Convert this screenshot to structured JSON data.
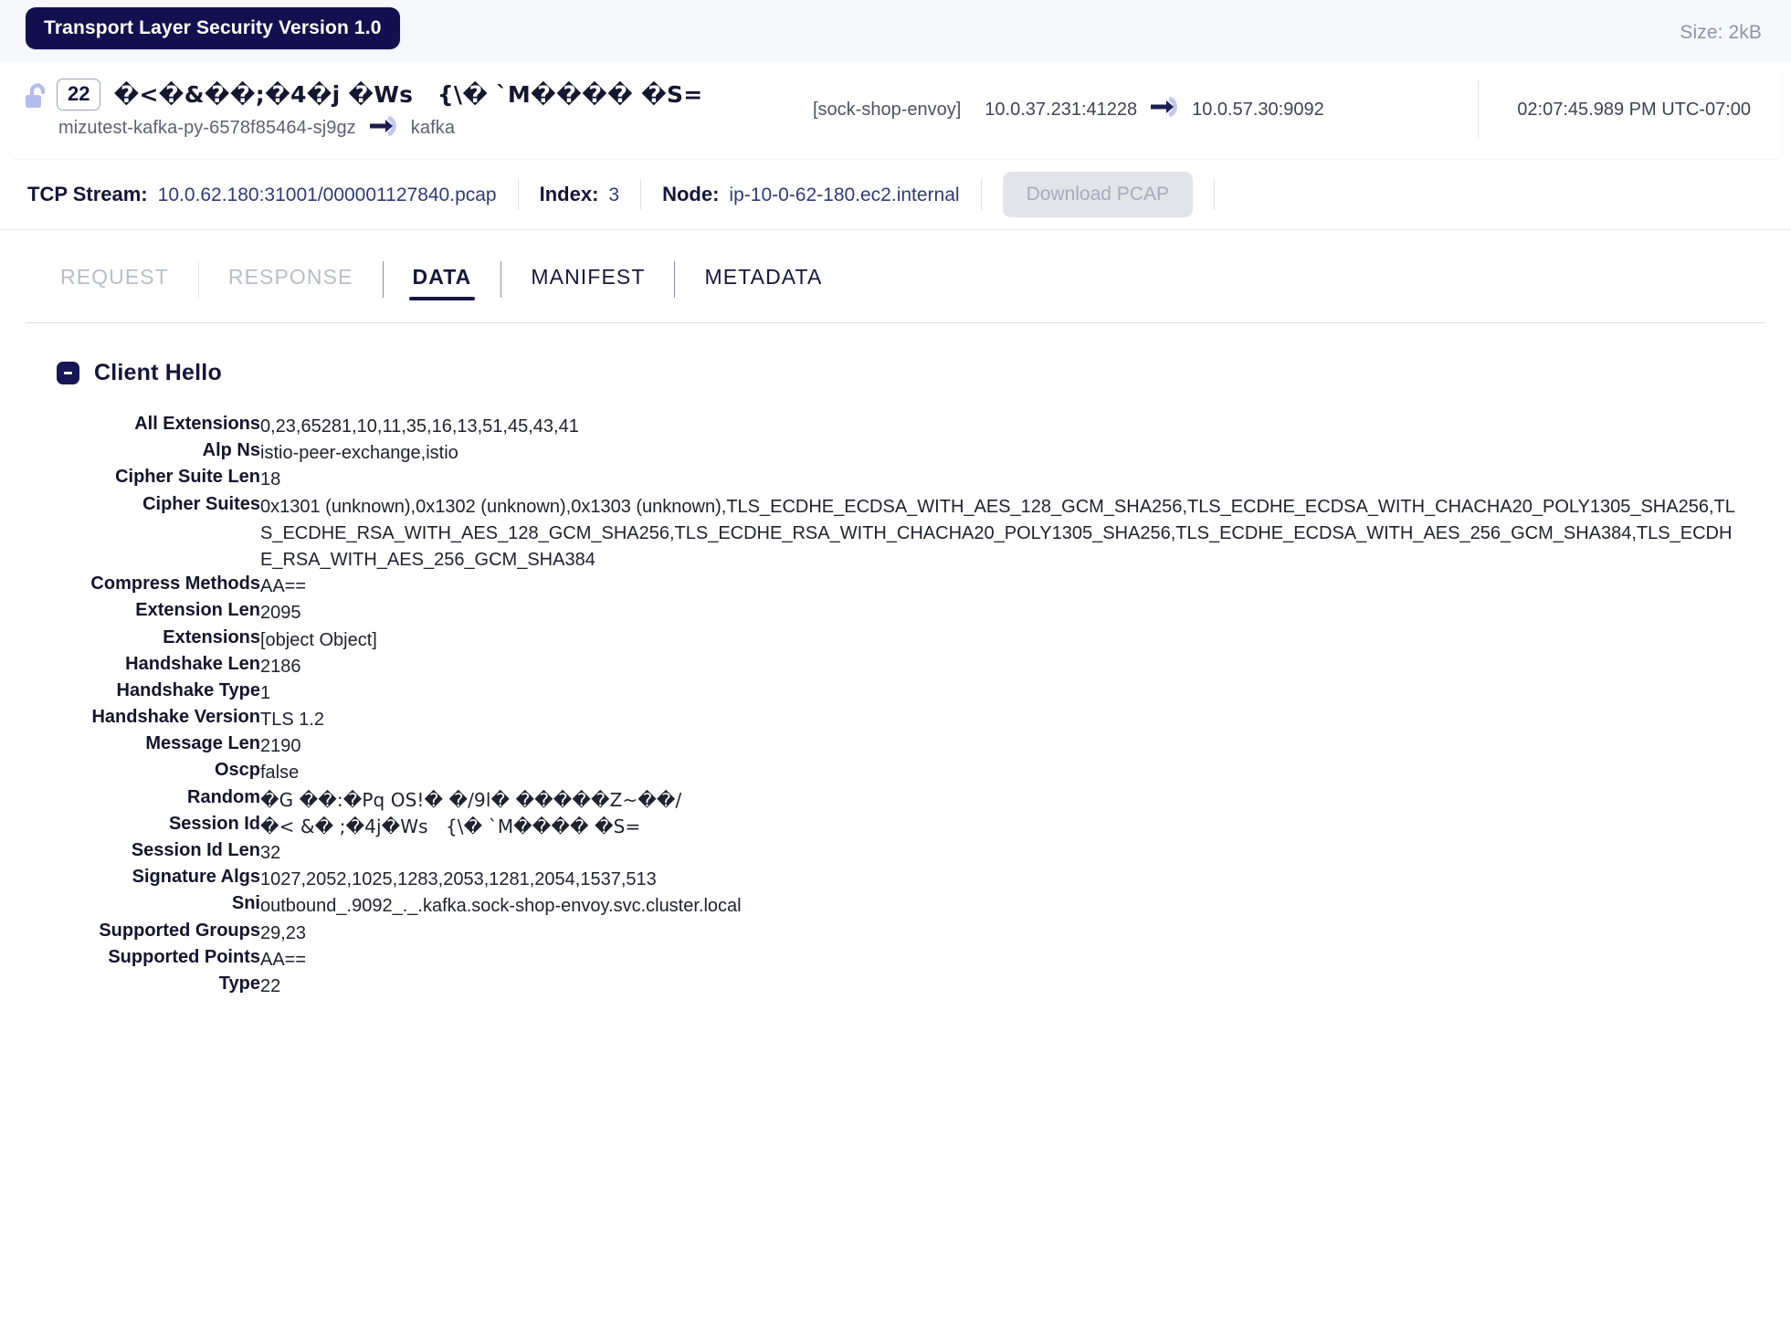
{
  "header": {
    "protocol_pill": "Transport Layer Security Version 1.0",
    "size_label": "Size: 2kB",
    "unlock_icon": "unlock-icon",
    "port_badge": "22",
    "payload_preview": "�<�&��;�4�j �Ws   {\\� `M���� �S=",
    "pod_name": "mizutest-kafka-py-6578f85464-sj9gz",
    "flow_arrow_icon": "arrow-right-icon",
    "service_name": "kafka",
    "envoy_tag": "[sock-shop-envoy]",
    "src_addr": "10.0.37.231:41228",
    "addr_arrow_icon": "arrow-right-icon",
    "dst_addr": "10.0.57.30:9092",
    "timestamp": "02:07:45.989 PM UTC-07:00"
  },
  "stream_bar": {
    "tcp_stream_key": "TCP Stream:",
    "tcp_stream_value": "10.0.62.180:31001/000001127840.pcap",
    "index_key": "Index:",
    "index_value": "3",
    "node_key": "Node:",
    "node_value": "ip-10-0-62-180.ec2.internal",
    "download_button": "Download PCAP"
  },
  "tabs": [
    {
      "label": "REQUEST",
      "state": "disabled"
    },
    {
      "label": "RESPONSE",
      "state": "disabled"
    },
    {
      "label": "DATA",
      "state": "active"
    },
    {
      "label": "MANIFEST",
      "state": "normal"
    },
    {
      "label": "METADATA",
      "state": "normal"
    }
  ],
  "section": {
    "title": "Client Hello",
    "collapse_icon": "minus-icon",
    "expanded": true,
    "fields": [
      {
        "key": "All Extensions",
        "value": "0,23,65281,10,11,35,16,13,51,45,43,41"
      },
      {
        "key": "Alp Ns",
        "value": "istio-peer-exchange,istio"
      },
      {
        "key": "Cipher Suite Len",
        "value": "18"
      },
      {
        "key": "Cipher Suites",
        "value": "0x1301 (unknown),0x1302 (unknown),0x1303 (unknown),TLS_ECDHE_ECDSA_WITH_AES_128_GCM_SHA256,TLS_ECDHE_ECDSA_WITH_CHACHA20_POLY1305_SHA256,TLS_ECDHE_RSA_WITH_AES_128_GCM_SHA256,TLS_ECDHE_RSA_WITH_CHACHA20_POLY1305_SHA256,TLS_ECDHE_ECDSA_WITH_AES_256_GCM_SHA384,TLS_ECDHE_RSA_WITH_AES_256_GCM_SHA384"
      },
      {
        "key": "Compress Methods",
        "value": "AA=="
      },
      {
        "key": "Extension Len",
        "value": "2095"
      },
      {
        "key": "Extensions",
        "value": "[object Object]"
      },
      {
        "key": "Handshake Len",
        "value": "2186"
      },
      {
        "key": "Handshake Type",
        "value": "1"
      },
      {
        "key": "Handshake Version",
        "value": "TLS 1.2"
      },
      {
        "key": "Message Len",
        "value": "2190"
      },
      {
        "key": "Oscp",
        "value": "false"
      },
      {
        "key": "Random",
        "value": "�G ��:�Pq OS!� �/9l� �����Z~��/"
      },
      {
        "key": "Session Id",
        "value": "�< &� ;�4j�Ws   {\\� `M���� �S="
      },
      {
        "key": "Session Id Len",
        "value": "32"
      },
      {
        "key": "Signature Algs",
        "value": "1027,2052,1025,1283,2053,1281,2054,1537,513"
      },
      {
        "key": "Sni",
        "value": "outbound_.9092_._.kafka.sock-shop-envoy.svc.cluster.local"
      },
      {
        "key": "Supported Groups",
        "value": "29,23"
      },
      {
        "key": "Supported Points",
        "value": "AA=="
      },
      {
        "key": "Type",
        "value": "22"
      }
    ]
  },
  "colors": {
    "brand_navy": "#12104f",
    "strip_bg": "#f7f8fc",
    "link_blue": "#2f3a7a",
    "muted": "#8d93a8",
    "lock_lavender": "#b4bcee"
  }
}
